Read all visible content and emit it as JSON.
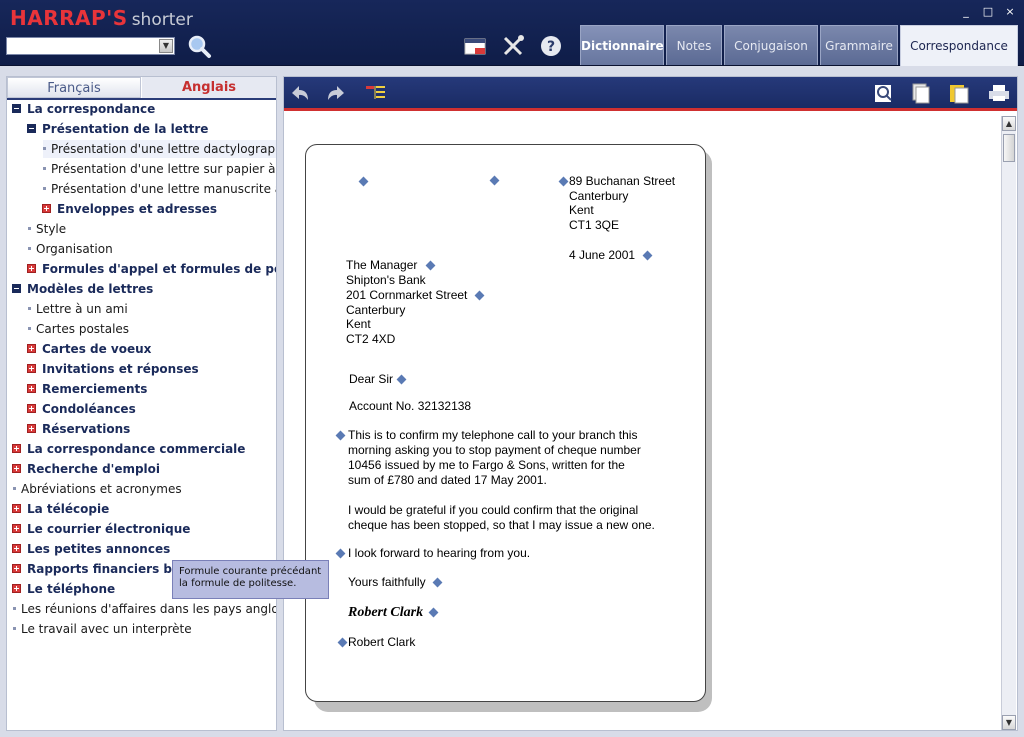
{
  "app": {
    "brand": "HARRAP'S",
    "edition": "shorter"
  },
  "search": {
    "value": "",
    "placeholder": ""
  },
  "icons": {
    "search": "magnifier-icon",
    "notes": "window-icon",
    "tools": "tools-icon",
    "help": "help-icon"
  },
  "tabs": [
    {
      "label": "Dictionnaire"
    },
    {
      "label": "Notes"
    },
    {
      "label": "Conjugaison"
    },
    {
      "label": "Grammaire"
    },
    {
      "label": "Correspondance"
    }
  ],
  "window_controls": [
    "_",
    "□",
    "×"
  ],
  "lang_tabs": {
    "fr": "Français",
    "en": "Anglais"
  },
  "tree": [
    {
      "label": "La correspondance"
    },
    {
      "label": "Présentation de la lettre"
    },
    {
      "label": "Présentation d'une lettre dactylographiée"
    },
    {
      "label": "Présentation d'une lettre sur papier à en-tête"
    },
    {
      "label": "Présentation d'une lettre manuscrite à un ami"
    },
    {
      "label": "Enveloppes et adresses"
    },
    {
      "label": "Style"
    },
    {
      "label": "Organisation"
    },
    {
      "label": "Formules d'appel et formules de politesse"
    },
    {
      "label": "Modèles de lettres"
    },
    {
      "label": "Lettre à un ami"
    },
    {
      "label": "Cartes postales"
    },
    {
      "label": "Cartes de voeux"
    },
    {
      "label": "Invitations et réponses"
    },
    {
      "label": "Remerciements"
    },
    {
      "label": "Condoléances"
    },
    {
      "label": "Réservations"
    },
    {
      "label": "La correspondance commerciale"
    },
    {
      "label": "Recherche d'emploi"
    },
    {
      "label": "Abréviations et acronymes"
    },
    {
      "label": "La télécopie"
    },
    {
      "label": "Le courrier électronique"
    },
    {
      "label": "Les petites annonces"
    },
    {
      "label": "Rapports financiers britanniques"
    },
    {
      "label": "Le téléphone"
    },
    {
      "label": "Les réunions d'affaires dans les pays anglo-saxons"
    },
    {
      "label": "Le travail avec un interprète"
    }
  ],
  "tooltip": {
    "line1": "Formule courante précédant",
    "line2": "la formule de politesse."
  },
  "letter": {
    "sender": [
      "89 Buchanan Street",
      "Canterbury",
      "Kent",
      "CT1 3QE"
    ],
    "date": "4 June 2001",
    "recipient": [
      "The Manager",
      "Shipton's Bank",
      "201 Cornmarket Street",
      "Canterbury",
      "Kent",
      "CT2 4XD"
    ],
    "greeting": "Dear Sir",
    "reference": "Account No. 32132138",
    "para1": [
      "This is to confirm my telephone call to your branch this",
      "morning asking you to stop payment of cheque number",
      "10456 issued by me to Fargo & Sons, written for the",
      "sum of £780 and dated 17 May 2001."
    ],
    "para2": [
      "I would be grateful if you could confirm that the original",
      "cheque has been stopped, so that I may issue a new one."
    ],
    "closing_line": "I look forward to hearing from you.",
    "signoff": "Yours faithfully",
    "signature": "Robert Clark",
    "name": "Robert Clark"
  },
  "colors": {
    "titlebar": "#17275a",
    "brand_red": "#e8343a",
    "accent_red": "#d03030",
    "marker": "#5a7ab4",
    "tooltip_bg": "#b7bce0"
  }
}
